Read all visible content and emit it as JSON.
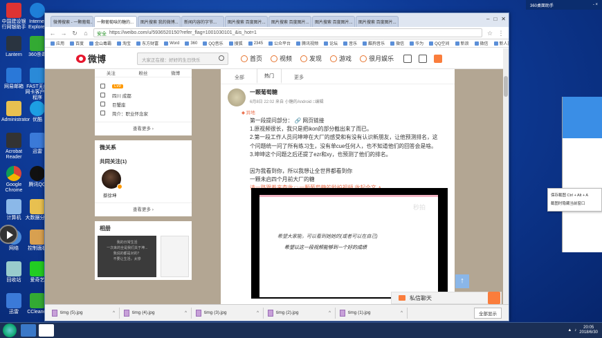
{
  "desktop": {
    "icons": [
      {
        "label": "中国建设银行网银助手"
      },
      {
        "label": "Internet Explorer"
      },
      {
        "label": "Lantern"
      },
      {
        "label": "360杀毒"
      },
      {
        "label": "网易邮箱"
      },
      {
        "label": "FAST无线网卡客户端程序"
      },
      {
        "label": "Administrator"
      },
      {
        "label": "优酷"
      },
      {
        "label": "Acrobat Reader"
      },
      {
        "label": "迅雷"
      },
      {
        "label": "Google Chrome"
      },
      {
        "label": "腾讯QQ"
      },
      {
        "label": "计算机"
      },
      {
        "label": "大数据分析"
      },
      {
        "label": "网络"
      },
      {
        "label": "控制面板"
      },
      {
        "label": "回收站"
      },
      {
        "label": "爱奇艺"
      },
      {
        "label": "迅雷"
      },
      {
        "label": "CCleaner"
      }
    ],
    "topright": {
      "label": "360桌面助手",
      "minimize": "-",
      "close": "×"
    },
    "context_menu": {
      "items": [
        "保存截图 Ctrl + Alt + A",
        "截图时隐藏当前窗口"
      ]
    }
  },
  "browser": {
    "tabs": [
      {
        "label": "微博搜索 - 一颗葡萄..."
      },
      {
        "label": "一颗葡萄味的糖的..."
      },
      {
        "label": "图片搜索 我的微博..."
      },
      {
        "label": "新闻内容的字节..."
      },
      {
        "label": "图片搜索 百度图片..."
      },
      {
        "label": "图片搜索 百度图片..."
      },
      {
        "label": "图片搜索 百度图片..."
      },
      {
        "label": "图片搜索 百度图片..."
      }
    ],
    "url": {
      "secure": "安全",
      "address": "https://weibo.com/u/5936520150?refer_flag=1001030101_&is_hot=1"
    },
    "bookmarks": [
      "应用",
      "百度",
      "金山毒霸",
      "淘宝",
      "东方财富",
      "Word",
      "360",
      "QQ音乐",
      "搜狐",
      "2345",
      "公众平台",
      "腾讯视频",
      "论坛",
      "音乐",
      "酷狗音乐",
      "微信",
      "华为",
      "QQ空间",
      "新浪",
      "微信",
      "新人数据表格小窗口..."
    ]
  },
  "weibo": {
    "header": {
      "logo": "微博",
      "search_placeholder": "大家正在搜：好好的生日快乐",
      "nav": [
        "首页",
        "视频",
        "发现",
        "游戏",
        "很月娱乐"
      ]
    },
    "profile": {
      "stats": [
        "关注",
        "粉丝",
        "微博"
      ],
      "level_tag": "Lv9",
      "location": "四川 成都",
      "gender": "巨蟹座",
      "intro": "简介：职业怀念家",
      "more": "查看更多 ›"
    },
    "relations": {
      "title": "微关系",
      "common_label": "共同关注(1)",
      "friend_name": "蔡徐坤",
      "more": "查看更多 ›"
    },
    "album": {
      "title": "相册",
      "caption_lines": [
        "我的日常生活",
        "一次来的全是我们关于坤...",
        "我说的都是对的？",
        "不要让生活，太惨"
      ]
    },
    "filter_tabs": [
      "全部",
      "热门",
      "更多"
    ],
    "post": {
      "author": "一颗葡萄糖",
      "meta": "6月8日 22:02 来自 小糖的Android  □编辑",
      "location": "◆ 异地",
      "lines": [
        "第一段提问部分：  🔗 网页链接",
        "1.原视频很长，我只是把ikon的部分截出来了而已。",
        "2.第一段工作人员问坤坤在大厂的感受和有没有认识新朋友，让他预测排名，这",
        "个问题统一问了所有练习生，没有单cue任何人，也不知道他们的回答会是啥。",
        "3.坤坤这个问题之后还提了ezr和xy，也预测了他们的排名。",
        "",
        "因为我看到你，所以我想让全世界都看到你",
        "一颗未启四个月前大厂的糖",
        "请一路跟着来查收  □ 一颗葡萄糖的秒拍视频 收起全文 ∧"
      ],
      "video_watermark": "秒拍",
      "video_caption1": "希望大家能，可以看到她她的(或者可以在自己)",
      "video_caption2": "希望以这一段视频能够到一个好的成绩"
    },
    "chat": {
      "label": "私信聊天"
    }
  },
  "downloads": {
    "items": [
      "timg (5).jpg",
      "timg (4).jpg",
      "timg (3).jpg",
      "timg (2).jpg",
      "timg (1).jpg"
    ],
    "show_all": "全部显示"
  },
  "taskbar": {
    "time": "20:05",
    "date": "2018/6/30"
  }
}
